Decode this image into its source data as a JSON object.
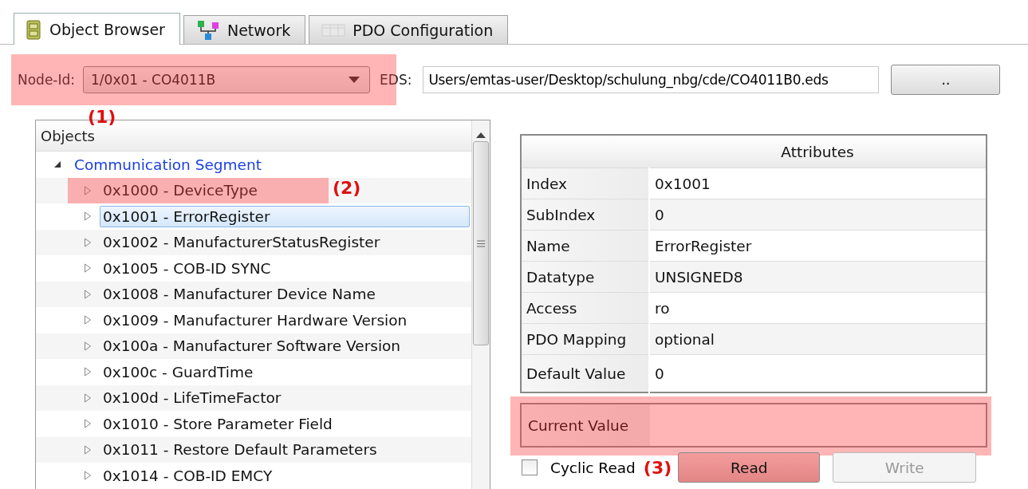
{
  "tabs": [
    {
      "label": "Object Browser",
      "selected": true
    },
    {
      "label": "Network",
      "selected": false
    },
    {
      "label": "PDO Configuration",
      "selected": false
    }
  ],
  "node_id": {
    "label": "Node-Id:",
    "value": "1/0x01 - CO4011B",
    "highlighted": true,
    "annotation": "(1)"
  },
  "eds": {
    "label": "EDS:",
    "value": "Users/emtas-user/Desktop/schulung_nbg/cde/CO4011B0.eds"
  },
  "browse_button": "..",
  "objects": {
    "header": "Objects",
    "tree": [
      {
        "label": "Communication Segment",
        "expanded": true,
        "children": [
          {
            "label": "0x1000 - DeviceType",
            "expanded": false,
            "selected": false,
            "highlighted": true,
            "annotation": "(2)"
          },
          {
            "label": "0x1001 - ErrorRegister",
            "expanded": false,
            "selected": true
          },
          {
            "label": "0x1002 - ManufacturerStatusRegister",
            "expanded": false,
            "selected": false
          },
          {
            "label": "0x1005 - COB-ID SYNC",
            "expanded": false,
            "selected": false
          },
          {
            "label": "0x1008 - Manufacturer Device Name",
            "expanded": false,
            "selected": false
          },
          {
            "label": "0x1009 - Manufacturer Hardware Version",
            "expanded": false,
            "selected": false
          },
          {
            "label": "0x100a - Manufacturer Software Version",
            "expanded": false,
            "selected": false
          },
          {
            "label": "0x100c - GuardTime",
            "expanded": false,
            "selected": false
          },
          {
            "label": "0x100d - LifeTimeFactor",
            "expanded": false,
            "selected": false
          },
          {
            "label": "0x1010 - Store Parameter Field",
            "expanded": false,
            "selected": false
          },
          {
            "label": "0x1011 - Restore Default Parameters",
            "expanded": false,
            "selected": false
          },
          {
            "label": "0x1014 - COB-ID EMCY",
            "expanded": false,
            "selected": false
          }
        ]
      }
    ]
  },
  "attributes": {
    "header": "Attributes",
    "rows": [
      {
        "name": "Index",
        "value": "0x1001"
      },
      {
        "name": "SubIndex",
        "value": "0"
      },
      {
        "name": "Name",
        "value": "ErrorRegister"
      },
      {
        "name": "Datatype",
        "value": "UNSIGNED8"
      },
      {
        "name": "Access",
        "value": "ro"
      },
      {
        "name": "PDO Mapping",
        "value": "optional"
      },
      {
        "name": "Default Value",
        "value": "0"
      }
    ]
  },
  "current_value": {
    "label": "Current Value",
    "highlighted": true
  },
  "cyclic_read": {
    "label": "Cyclic Read",
    "checked": false
  },
  "buttons": [
    {
      "label": "Read",
      "disabled": false,
      "highlighted": true,
      "annotation": "(3)"
    },
    {
      "label": "Write",
      "disabled": true,
      "highlighted": false
    }
  ]
}
